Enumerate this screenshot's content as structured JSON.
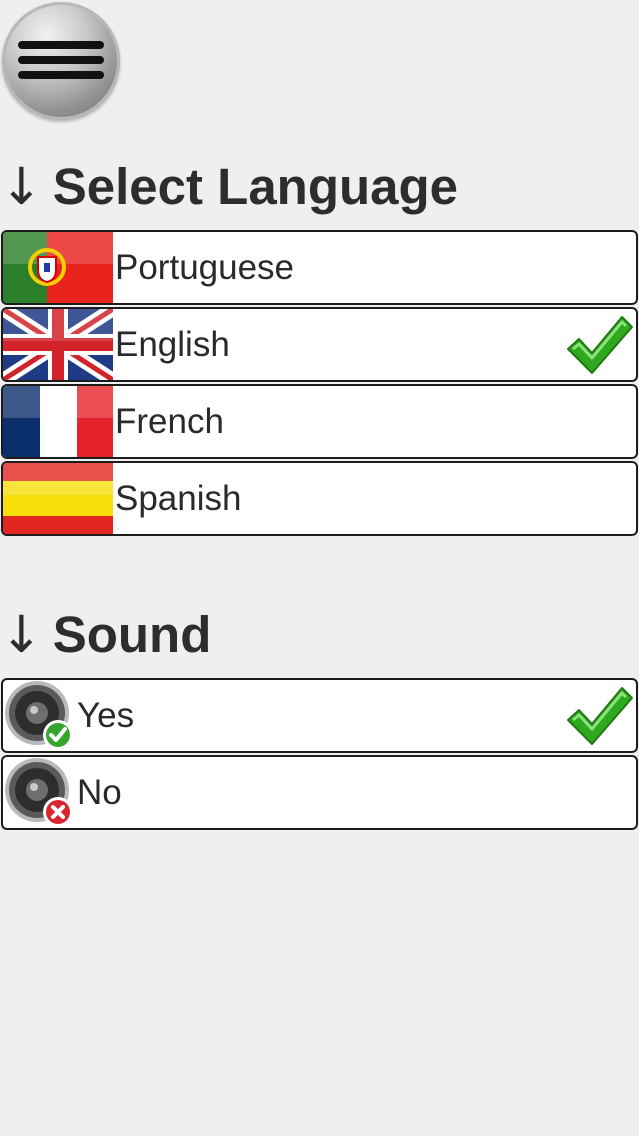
{
  "menu": {
    "icon": "hamburger-menu-icon"
  },
  "language_section": {
    "arrow": "↓",
    "title": "Select Language",
    "options": [
      {
        "label": "Portuguese",
        "icon": "portugal-flag-icon",
        "selected": false
      },
      {
        "label": "English",
        "icon": "uk-flag-icon",
        "selected": true
      },
      {
        "label": "French",
        "icon": "france-flag-icon",
        "selected": false
      },
      {
        "label": "Spanish",
        "icon": "spain-flag-icon",
        "selected": false
      }
    ]
  },
  "sound_section": {
    "arrow": "↓",
    "title": "Sound",
    "options": [
      {
        "label": "Yes",
        "icon": "speaker-on-icon",
        "selected": true
      },
      {
        "label": "No",
        "icon": "speaker-off-icon",
        "selected": false
      }
    ]
  },
  "colors": {
    "background": "#efeff1",
    "row_background": "#ffffff",
    "row_border": "#1c1c1c",
    "text": "#2d2d2d",
    "check_green": "#2ea81e"
  }
}
